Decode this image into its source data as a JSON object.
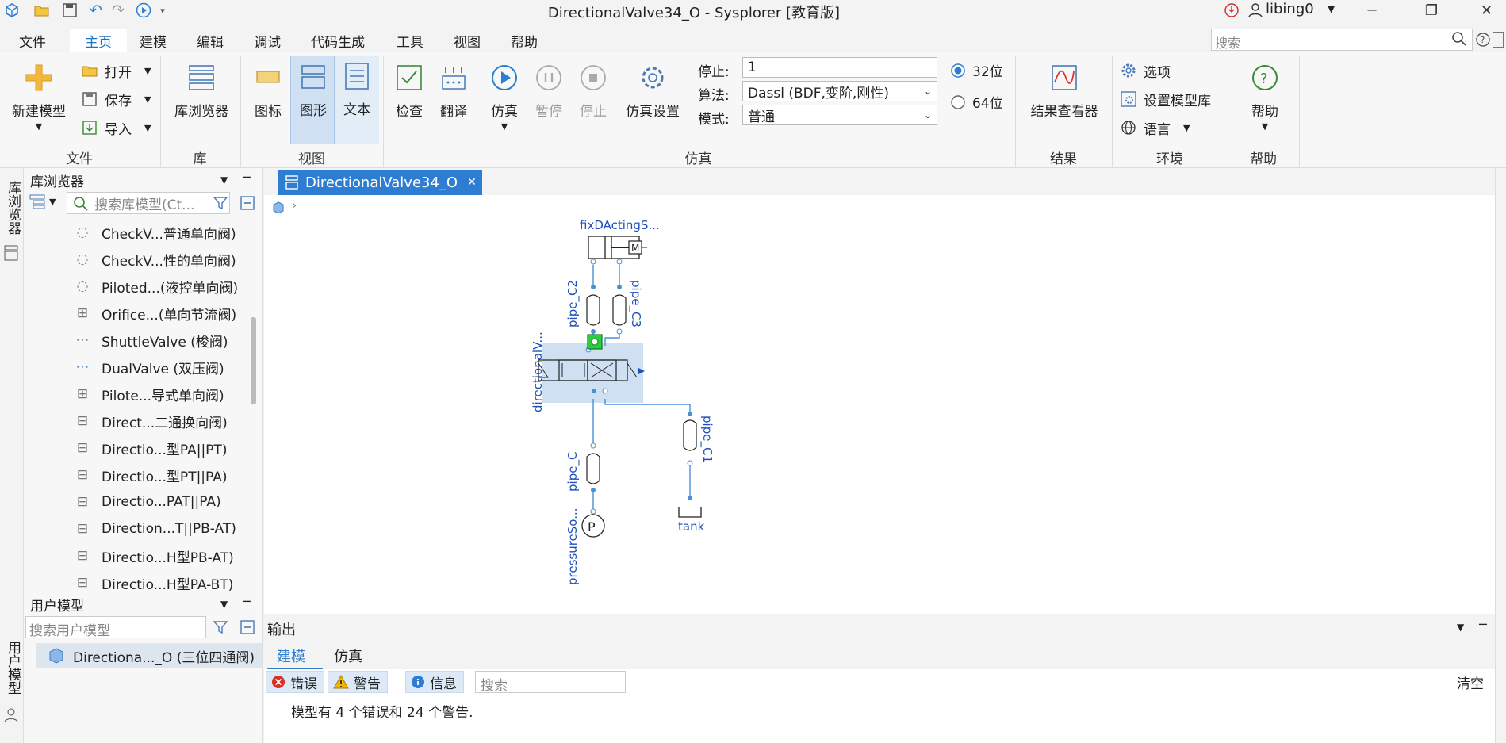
{
  "titlebar": {
    "title": "DirectionalValve34_O - Sysplorer [教育版]",
    "user": "libing0"
  },
  "menubar": {
    "items": [
      "文件",
      "主页",
      "建模",
      "编辑",
      "调试",
      "代码生成",
      "工具",
      "视图",
      "帮助"
    ],
    "active": "主页",
    "search_placeholder": "搜索"
  },
  "ribbon": {
    "file": {
      "new_model": "新建模型",
      "open": "打开",
      "save": "保存",
      "import": "导入",
      "group": "文件"
    },
    "lib": {
      "browser": "库浏览器",
      "group": "库"
    },
    "view": {
      "icon": "图标",
      "diagram": "图形",
      "text": "文本",
      "group": "视图"
    },
    "sim": {
      "check": "检查",
      "translate": "翻译",
      "simulate": "仿真",
      "pause": "暂停",
      "stop": "停止",
      "settings": "仿真设置",
      "stop_label": "停止:",
      "stop_value": "1",
      "algo_label": "算法:",
      "algo_value": "Dassl (BDF,变阶,刚性)",
      "mode_label": "模式:",
      "mode_value": "普通",
      "bit32": "32位",
      "bit64": "64位",
      "bit_selected": "32位",
      "group": "仿真"
    },
    "result": {
      "viewer": "结果查看器",
      "group": "结果"
    },
    "env": {
      "options": "选项",
      "set_lib": "设置模型库",
      "language": "语言",
      "group": "环境"
    },
    "help": {
      "help": "帮助",
      "group": "帮助"
    }
  },
  "left_strip": {
    "lib_tab": "库浏览器",
    "user_tab": "用户模型"
  },
  "library_browser": {
    "title": "库浏览器",
    "search_placeholder": "搜索库模型(Ct...",
    "items": [
      "CheckV...普通单向阀)",
      "CheckV...性的单向阀)",
      "Piloted...(液控单向阀)",
      "Orifice...(单向节流阀)",
      "ShuttleValve (梭阀)",
      "DualValve (双压阀)",
      "Pilote...导式单向阀)",
      "Direct...二通换向阀)",
      "Directio...型PA||PT)",
      "Directio...型PT||PA)",
      "Directio...PAT||PA)",
      "Direction...T||PB-AT)",
      "Directio...H型PB-AT)",
      "Directio...H型PA-BT)"
    ]
  },
  "user_models": {
    "title": "用户模型",
    "search_placeholder": "搜索用户模型",
    "items": [
      "Directiona..._O (三位四通阀)"
    ]
  },
  "document": {
    "tab_title": "DirectionalValve34_O"
  },
  "diagram": {
    "labels": {
      "cylinder": "fixDActingS...",
      "pipe_c2": "pipe_C2",
      "pipe_c3": "pipe_C3",
      "valve": "directionalV...",
      "pipe_c": "pipe_C",
      "pipe_c1": "pipe_C1",
      "tank": "tank",
      "pressure": "pressureSo..."
    }
  },
  "output": {
    "title": "输出",
    "tabs": [
      "建模",
      "仿真"
    ],
    "active_tab": "建模",
    "errors_label": "错误",
    "warnings_label": "警告",
    "info_label": "信息",
    "search_placeholder": "搜索",
    "clear": "清空",
    "message": "模型有 4 个错误和 24 个警告."
  },
  "colors": {
    "accent": "#2d7dd2",
    "diagram_blue": "#1f4fbf",
    "selected_bg": "#cfe0f2"
  }
}
